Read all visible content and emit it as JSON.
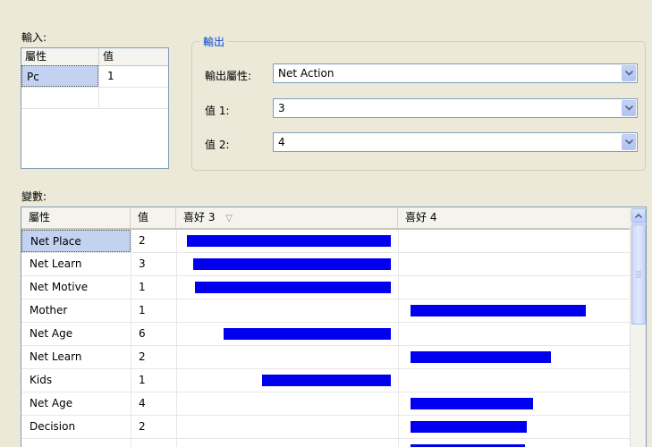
{
  "input_section": {
    "label": "輸入:",
    "columns": [
      "屬性",
      "值"
    ],
    "rows": [
      {
        "attribute": "Pc",
        "value": "1"
      }
    ]
  },
  "output_section": {
    "title": "輸出",
    "output_attribute_label": "輸出屬性:",
    "output_attribute_value": "Net Action",
    "value1_label": "值 1:",
    "value1_value": "3",
    "value2_label": "值 2:",
    "value2_value": "4"
  },
  "variables_section": {
    "label": "變數:",
    "columns": [
      "屬性",
      "值",
      "喜好 3",
      "喜好 4"
    ],
    "sort_indicator": "▽",
    "rows": [
      {
        "attribute": "Net Place",
        "value": "2",
        "favors": "3",
        "strength": 1.0
      },
      {
        "attribute": "Net Learn",
        "value": "3",
        "favors": "3",
        "strength": 0.97
      },
      {
        "attribute": "Net Motive",
        "value": "1",
        "favors": "3",
        "strength": 0.96
      },
      {
        "attribute": "Mother",
        "value": "1",
        "favors": "4",
        "strength": 0.86
      },
      {
        "attribute": "Net Age",
        "value": "6",
        "favors": "3",
        "strength": 0.82
      },
      {
        "attribute": "Net Learn",
        "value": "2",
        "favors": "4",
        "strength": 0.69
      },
      {
        "attribute": "Kids",
        "value": "1",
        "favors": "3",
        "strength": 0.63
      },
      {
        "attribute": "Net Age",
        "value": "4",
        "favors": "4",
        "strength": 0.6
      },
      {
        "attribute": "Decision",
        "value": "2",
        "favors": "4",
        "strength": 0.57
      },
      {
        "attribute": "",
        "value": "",
        "favors": "4",
        "strength": 0.56
      }
    ]
  },
  "colors": {
    "bar": "#0000ee",
    "selection": "#c2d2f0",
    "group_title": "#0046d5"
  }
}
